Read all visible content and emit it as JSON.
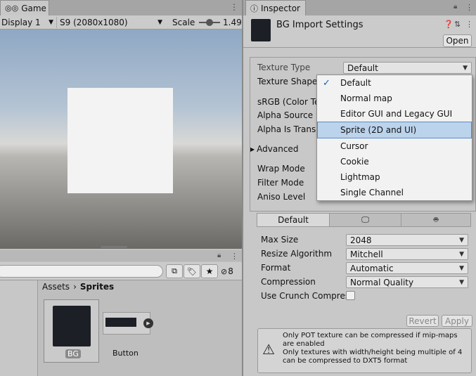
{
  "game": {
    "tab_label": "Game",
    "display_label": "Display 1",
    "resolution_label": "S9 (2080x1080)",
    "scale_label": "Scale",
    "scale_value": "1.49:"
  },
  "project": {
    "breadcrumb_root": "Assets",
    "breadcrumb_sep": "›",
    "breadcrumb_current": "Sprites",
    "hidden_count": "8",
    "assets": [
      {
        "label": "BG"
      },
      {
        "label": "Button"
      }
    ]
  },
  "inspector": {
    "tab_label": "Inspector",
    "title": "BG Import Settings",
    "open_label": "Open",
    "properties": [
      {
        "label": "Texture Type",
        "value": "Default"
      },
      {
        "label": "Texture Shape"
      },
      {
        "label": "sRGB (Color Te"
      },
      {
        "label": "Alpha Source"
      },
      {
        "label": "Alpha Is Transp"
      },
      {
        "label": "Advanced"
      },
      {
        "label": "Wrap Mode"
      },
      {
        "label": "Filter Mode"
      },
      {
        "label": "Aniso Level"
      }
    ],
    "dropdown": {
      "options": [
        "Default",
        "Normal map",
        "Editor GUI and Legacy GUI",
        "Sprite (2D and UI)",
        "Cursor",
        "Cookie",
        "Lightmap",
        "Single Channel"
      ],
      "selected_index": 0,
      "highlighted_index": 3
    },
    "platform_tab_default": "Default",
    "platform_settings": [
      {
        "label": "Max Size",
        "value": "2048"
      },
      {
        "label": "Resize Algorithm",
        "value": "Mitchell"
      },
      {
        "label": "Format",
        "value": "Automatic"
      },
      {
        "label": "Compression",
        "value": "Normal Quality"
      },
      {
        "label": "Use Crunch Compres",
        "value": ""
      }
    ],
    "revert_label": "Revert",
    "apply_label": "Apply",
    "warning_line1": "Only POT texture can be compressed if mip-maps are enabled",
    "warning_line2": "Only textures with width/height being multiple of 4 can be compressed to DXT5 format"
  },
  "colors": {
    "menu_highlight": "#bcd3ec",
    "menu_highlight_border": "#5a8bc4",
    "checkmark": "#1f5da8"
  }
}
